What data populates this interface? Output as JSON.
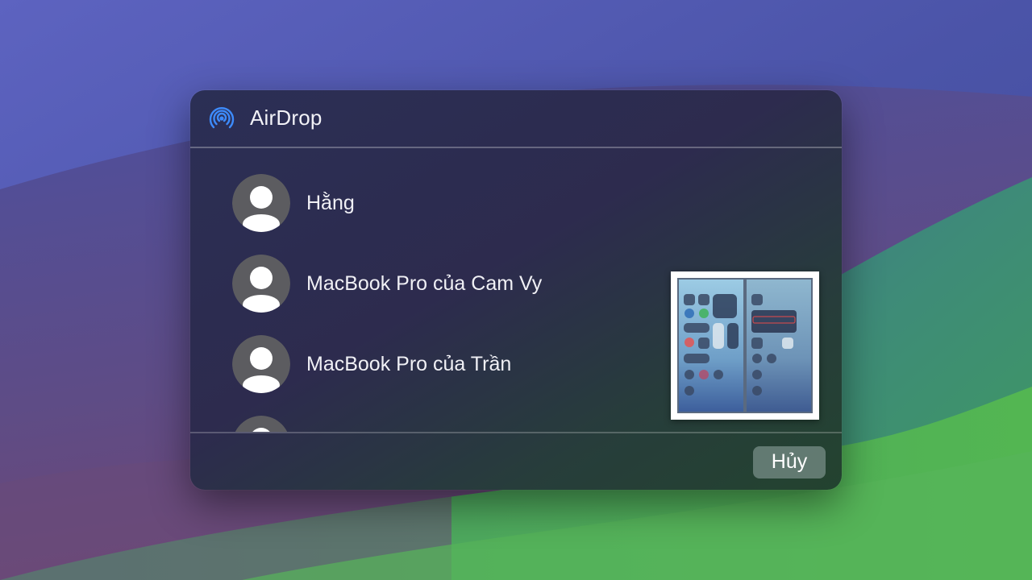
{
  "dialog": {
    "title": "AirDrop",
    "header_icon": "airdrop-icon",
    "recipients": [
      {
        "name": "Hằng",
        "avatar_icon": "person-icon"
      },
      {
        "name": "MacBook Pro của Cam Vy",
        "avatar_icon": "person-icon"
      },
      {
        "name": "MacBook Pro của Trần",
        "avatar_icon": "person-icon"
      },
      {
        "name": "",
        "avatar_icon": "person-icon"
      }
    ],
    "cancel_label": "Hủy"
  },
  "colors": {
    "accent": "#3d8bfd",
    "cancel_button_bg": "#7f9690"
  }
}
